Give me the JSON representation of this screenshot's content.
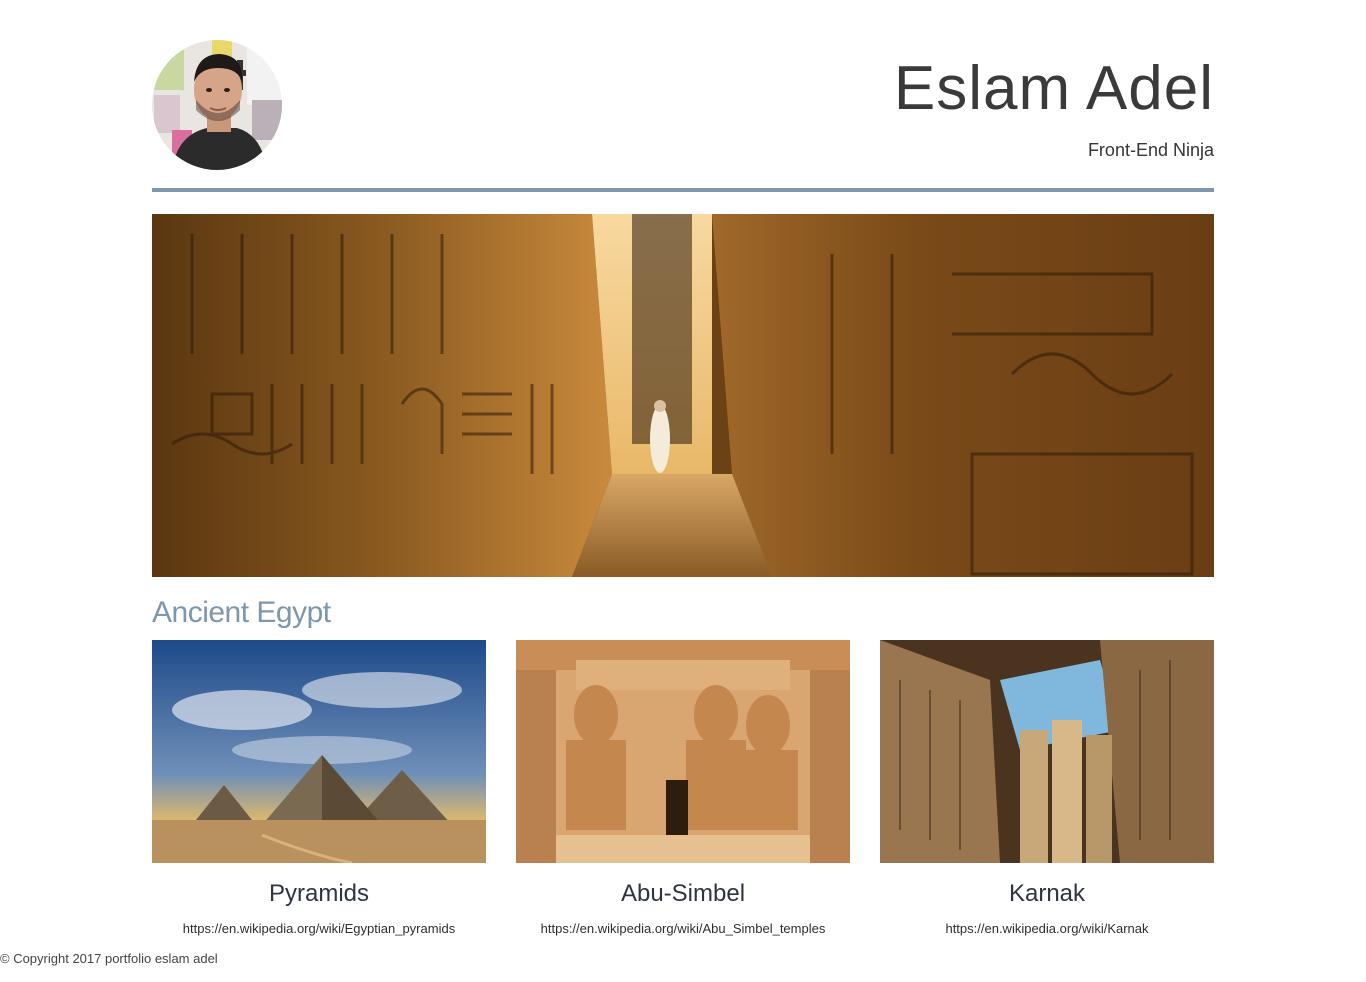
{
  "header": {
    "name": "Eslam Adel",
    "subtitle": "Front-End Ninja",
    "avatar_icon": "profile-photo"
  },
  "hero": {
    "image": "egyptian-temple-corridor"
  },
  "section": {
    "title": "Ancient Egypt"
  },
  "cards": [
    {
      "title": "Pyramids",
      "link": "https://en.wikipedia.org/wiki/Egyptian_pyramids",
      "image": "pyramids-photo"
    },
    {
      "title": "Abu-Simbel",
      "link": "https://en.wikipedia.org/wiki/Abu_Simbel_temples",
      "image": "abu-simbel-photo"
    },
    {
      "title": "Karnak",
      "link": "https://en.wikipedia.org/wiki/Karnak",
      "image": "karnak-photo"
    }
  ],
  "footer": {
    "text": "© Copyright 2017 portfolio eslam adel"
  },
  "colors": {
    "accent": "#7d97ad",
    "text": "#333333"
  }
}
